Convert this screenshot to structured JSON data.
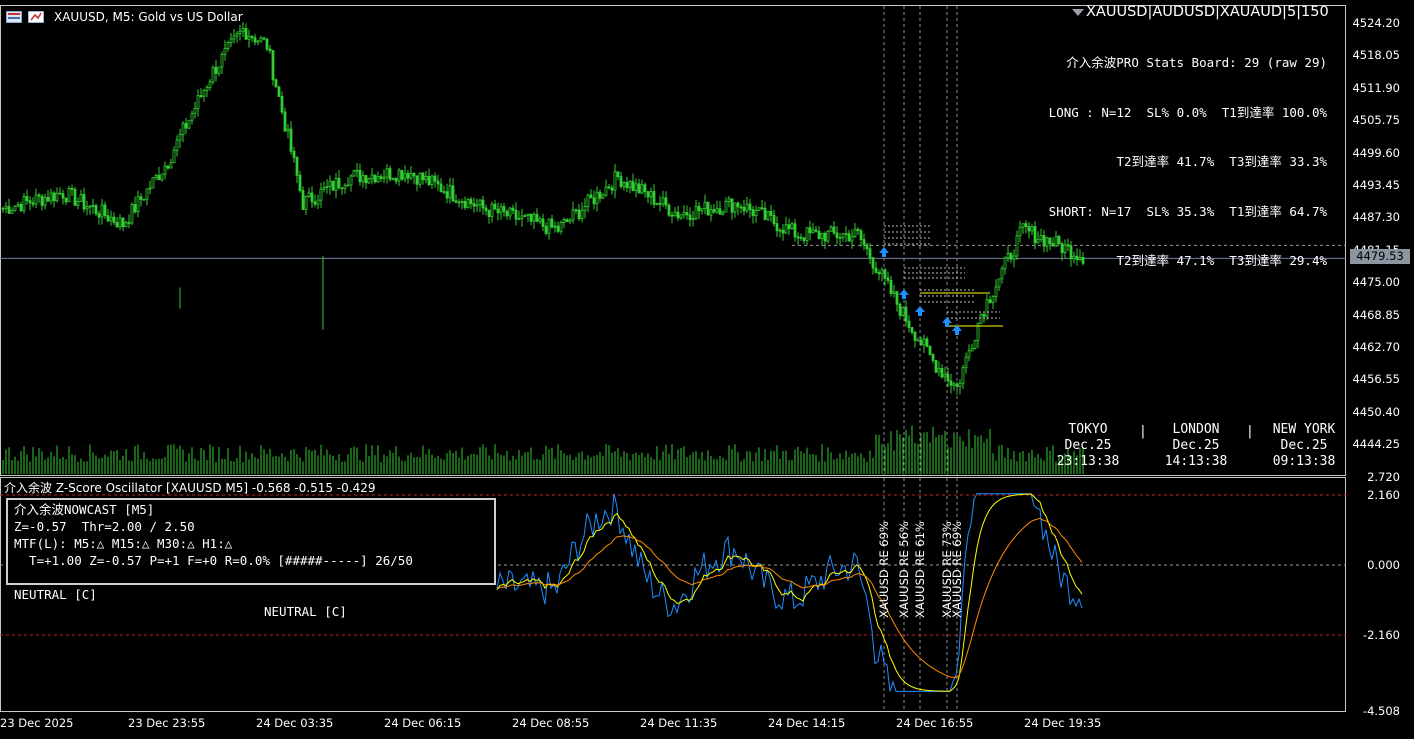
{
  "window": {
    "title": "XAUUSD, M5:  Gold vs US Dollar",
    "symbols_header": "XAUUSD|AUDUSD|XAUAUD|5|150"
  },
  "stats_board": {
    "title": "介入余波PRO Stats Board: 29 (raw 29)",
    "long_line1": "LONG : N=12  SL% 0.0%  T1到達率 100.0%",
    "long_line2": "T2到達率 41.7%  T3到達率 33.3%",
    "short_line1": "SHORT: N=17  SL% 35.3%  T1到達率 64.7%",
    "short_line2": "T2到達率 47.1%  T3到達率 29.4%"
  },
  "sessions": [
    {
      "name": "TOKYO",
      "date": "Dec.25",
      "time": "23:13:38"
    },
    {
      "name": "LONDON",
      "date": "Dec.25",
      "time": "14:13:38"
    },
    {
      "name": "NEW YORK",
      "date": "Dec.25",
      "time": "09:13:38"
    }
  ],
  "session_separator": "|",
  "price_axis": [
    "4524.20",
    "4518.05",
    "4511.90",
    "4505.75",
    "4499.60",
    "4493.45",
    "4487.30",
    "4481.15",
    "4475.00",
    "4468.85",
    "4462.70",
    "4456.55",
    "4450.40",
    "4444.25"
  ],
  "current_price": "4479.53",
  "oscillator": {
    "title": "介入余波 Z-Score Oscillator [XAUUSD M5] -0.568 -0.515 -0.429",
    "axis": [
      "2.720",
      "2.160",
      "0.000",
      "-2.160",
      "-4.508"
    ],
    "markers": [
      "XAUUSD RE 69%",
      "XAUUSD RE 56%",
      "XAUUSD RE 61%",
      "XAUUSD RE 73%",
      "XAUUSD RE 69%"
    ]
  },
  "nowcast": {
    "line1": "介入余波NOWCAST [M5]",
    "line2": "Z=-0.57  Thr=2.00 / 2.50",
    "line3": "MTF(L): M5:△ M15:△ M30:△ H1:△",
    "line4": "  T=+1.00 Z=-0.57 P=+1 F=+0 R=0.0% [#####-----] 26/50",
    "state_left": "NEUTRAL [C]",
    "state_right": "NEUTRAL [C]"
  },
  "time_axis": [
    "23 Dec 2025",
    "23 Dec 23:55",
    "24 Dec 03:35",
    "24 Dec 06:15",
    "24 Dec 08:55",
    "24 Dec 11:35",
    "24 Dec 14:15",
    "24 Dec 16:55",
    "24 Dec 19:35"
  ],
  "colors": {
    "candle": "#32cd32",
    "volume": "#32cd32",
    "osc_fast": "#1e90ff",
    "osc_mid": "#ffff00",
    "osc_slow": "#ff8c00",
    "threshold": "#c81e1e",
    "arrow": "#1e90ff"
  },
  "chart_data": {
    "type": "candlestick",
    "title": "XAUUSD, M5:  Gold vs US Dollar",
    "ylim": [
      4441,
      4527
    ],
    "current_price": 4479.53,
    "close_path_anchors": [
      {
        "index": 0,
        "price": 4489
      },
      {
        "index": 20,
        "price": 4492
      },
      {
        "index": 40,
        "price": 4486
      },
      {
        "index": 55,
        "price": 4498
      },
      {
        "index": 70,
        "price": 4515
      },
      {
        "index": 80,
        "price": 4523
      },
      {
        "index": 88,
        "price": 4520
      },
      {
        "index": 100,
        "price": 4490
      },
      {
        "index": 115,
        "price": 4495
      },
      {
        "index": 135,
        "price": 4496
      },
      {
        "index": 160,
        "price": 4489
      },
      {
        "index": 185,
        "price": 4485
      },
      {
        "index": 205,
        "price": 4495
      },
      {
        "index": 225,
        "price": 4488
      },
      {
        "index": 245,
        "price": 4490
      },
      {
        "index": 265,
        "price": 4484
      },
      {
        "index": 285,
        "price": 4484
      },
      {
        "index": 300,
        "price": 4469
      },
      {
        "index": 310,
        "price": 4460
      },
      {
        "index": 318,
        "price": 4455
      },
      {
        "index": 326,
        "price": 4469
      },
      {
        "index": 340,
        "price": 4485
      },
      {
        "index": 360,
        "price": 4480
      }
    ],
    "oscillator_ylim": [
      -4.508,
      2.72
    ],
    "oscillator_thresholds": [
      2.16,
      0,
      -2.16
    ]
  }
}
